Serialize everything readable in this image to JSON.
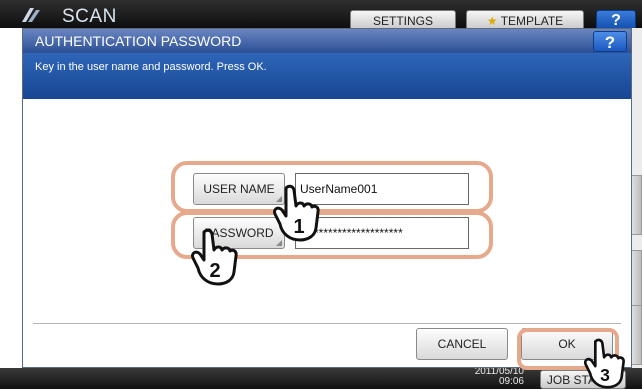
{
  "background_app": {
    "title": "SCAN",
    "settings_label": "SETTINGS",
    "template_label": "TEMPLATE",
    "help_label": "?",
    "datetime_line1": "2011/05/10",
    "datetime_line2": "09:06",
    "job_status_label": "JOB STATUS"
  },
  "dialog": {
    "title": "AUTHENTICATION PASSWORD",
    "help_label": "?",
    "message": "Key in the user name and password. Press OK.",
    "username": {
      "button_label": "USER NAME",
      "value": "UserName001"
    },
    "password": {
      "button_label": "PASSWORD",
      "value": "**********************"
    },
    "cancel_label": "CANCEL",
    "ok_label": "OK"
  },
  "callouts": {
    "step1": "1",
    "step2": "2",
    "step3": "3"
  },
  "colors": {
    "title_bar": "#2b4f96",
    "message_bar": "#164593",
    "highlight": "#e7a98b"
  }
}
